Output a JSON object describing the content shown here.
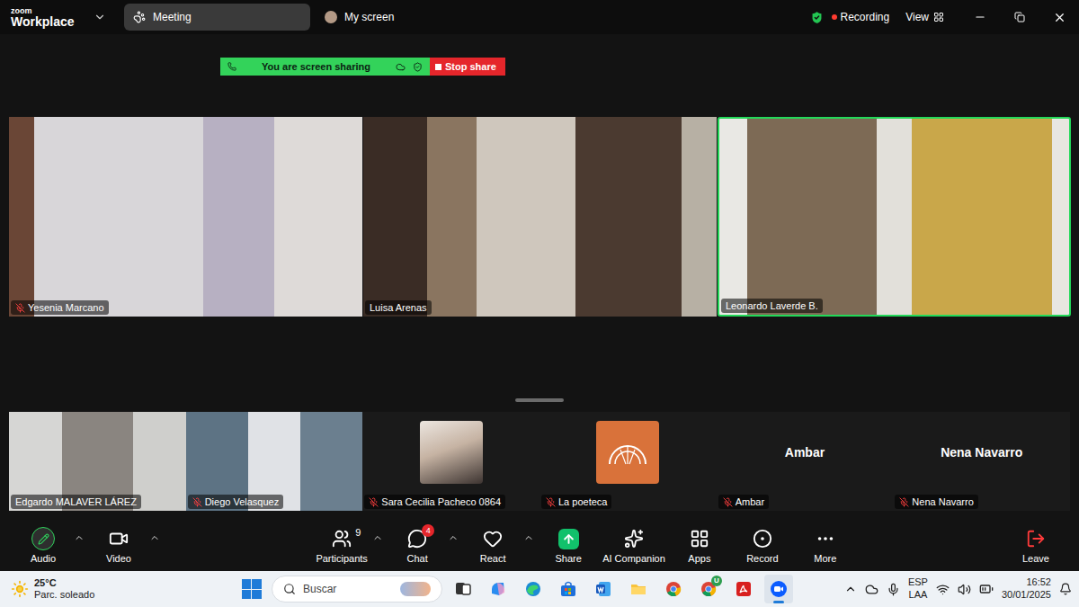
{
  "window": {
    "logo": "zoom",
    "product": "Workplace",
    "tabs": [
      {
        "label": "Meeting",
        "selected": true,
        "kind": "meeting"
      },
      {
        "label": "My screen",
        "selected": false,
        "kind": "screen"
      }
    ],
    "recording": "Recording",
    "view": "View"
  },
  "share_banner": {
    "status": "You are screen sharing",
    "stop": "Stop share"
  },
  "gallery": [
    {
      "name": "Yesenia Marcano",
      "muted": true,
      "active": false,
      "kind": "video"
    },
    {
      "name": "Luisa Arenas",
      "muted": false,
      "active": false,
      "kind": "video"
    },
    {
      "name": "Leonardo Laverde B.",
      "muted": false,
      "active": true,
      "kind": "video"
    }
  ],
  "strip": [
    {
      "name": "Edgardo MALAVER LÁREZ",
      "muted": false,
      "active": false,
      "kind": "video"
    },
    {
      "name": "Diego Velasquez",
      "muted": true,
      "active": false,
      "kind": "video"
    },
    {
      "name": "Sara Cecilia Pacheco 0864",
      "muted": true,
      "active": false,
      "kind": "avatar"
    },
    {
      "name": "La poeteca",
      "muted": true,
      "active": false,
      "kind": "logo"
    },
    {
      "name": "Ambar",
      "muted": true,
      "active": false,
      "kind": "name"
    },
    {
      "name": "Nena Navarro",
      "muted": true,
      "active": false,
      "kind": "name"
    }
  ],
  "toolbar": [
    {
      "label": "Audio",
      "kind": "audio",
      "group": "left",
      "menu": true
    },
    {
      "label": "Video",
      "kind": "video",
      "group": "left",
      "menu": true
    },
    {
      "label": "Participants",
      "kind": "participants",
      "group": "center",
      "menu": true,
      "count": "9"
    },
    {
      "label": "Chat",
      "kind": "chat",
      "group": "center",
      "menu": true,
      "badge": "4"
    },
    {
      "label": "React",
      "kind": "react",
      "group": "center",
      "menu": true
    },
    {
      "label": "Share",
      "kind": "share",
      "group": "center",
      "menu": false
    },
    {
      "label": "AI Companion",
      "kind": "ai",
      "group": "center",
      "menu": false
    },
    {
      "label": "Apps",
      "kind": "apps",
      "group": "center",
      "menu": false
    },
    {
      "label": "Record",
      "kind": "record",
      "group": "center",
      "menu": false
    },
    {
      "label": "More",
      "kind": "more",
      "group": "center",
      "menu": false
    },
    {
      "label": "Leave",
      "kind": "leave",
      "group": "right",
      "menu": false
    }
  ],
  "taskbar": {
    "weather": {
      "temp": "25°C",
      "condition": "Parc. soleado"
    },
    "search": {
      "placeholder": "Buscar"
    },
    "apps": [
      {
        "kind": "taskview",
        "selected": false
      },
      {
        "kind": "copilot",
        "selected": false
      },
      {
        "kind": "edge",
        "selected": false
      },
      {
        "kind": "store",
        "selected": false
      },
      {
        "kind": "word",
        "selected": false
      },
      {
        "kind": "explorer",
        "selected": false
      },
      {
        "kind": "chrome",
        "selected": false
      },
      {
        "kind": "chrome",
        "selected": false,
        "badge": "U"
      },
      {
        "kind": "acrobat",
        "selected": false
      },
      {
        "kind": "zoom",
        "selected": true
      }
    ],
    "language": {
      "lang": "ESP",
      "layout": "LAA"
    },
    "time": "16:52",
    "date": "30/01/2025"
  }
}
